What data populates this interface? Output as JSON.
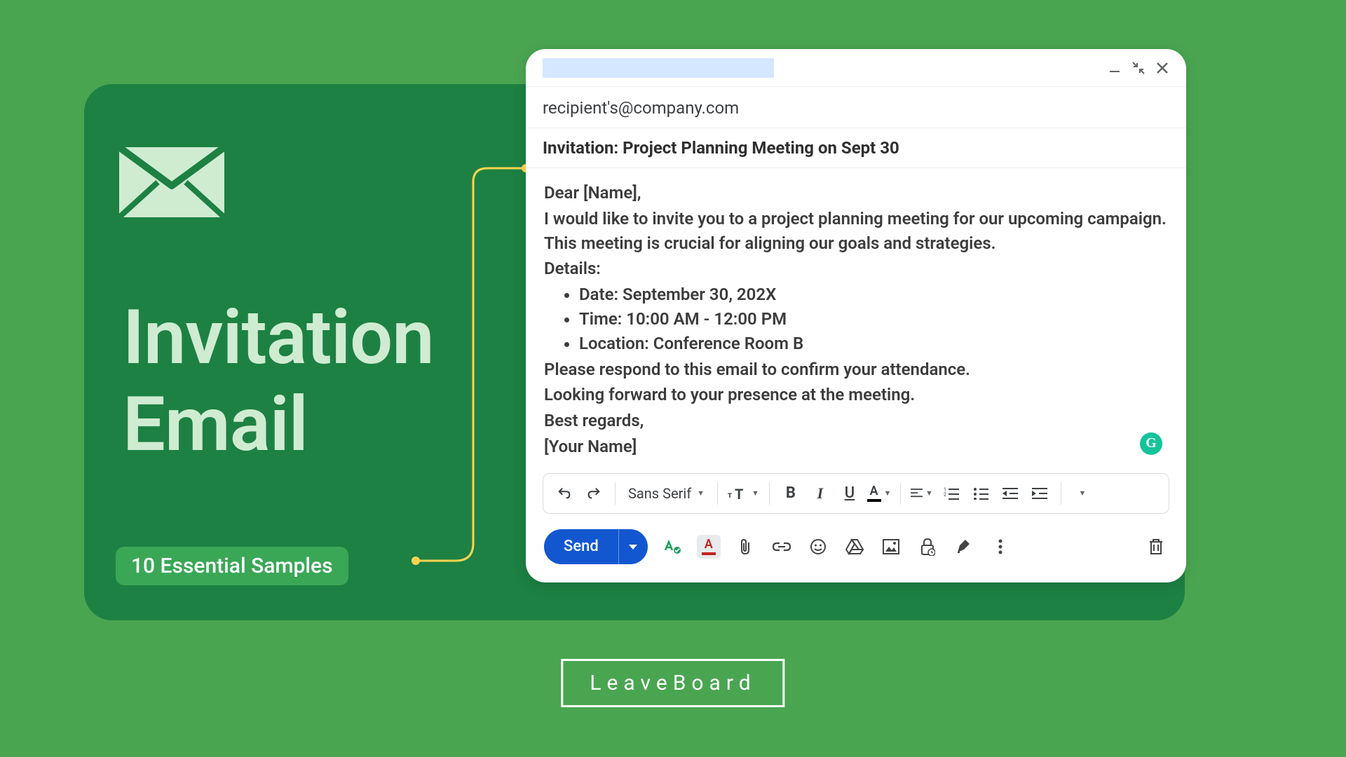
{
  "panel": {
    "title_line1": "Invitation",
    "title_line2": "Email",
    "badge": "10 Essential Samples"
  },
  "compose": {
    "recipient": "recipient's@company.com",
    "subject": "Invitation: Project Planning Meeting on Sept 30",
    "body": {
      "greeting": "Dear [Name],",
      "intro": "I would like to invite you to a project planning meeting for our upcoming campaign. This meeting is crucial for aligning our goals and strategies.",
      "details_label": "Details:",
      "bullets": {
        "date": "Date: September 30, 202X",
        "time": "Time: 10:00 AM - 12:00 PM",
        "location": "Location: Conference Room B"
      },
      "confirm": "Please respond to this email to confirm your attendance.",
      "closing1": "Looking forward to your presence at the meeting.",
      "closing2": "Best regards,",
      "signature": "[Your Name]"
    },
    "toolbar": {
      "font": "Sans Serif",
      "send_label": "Send"
    }
  },
  "footer": {
    "brand": "LeaveBoard"
  }
}
